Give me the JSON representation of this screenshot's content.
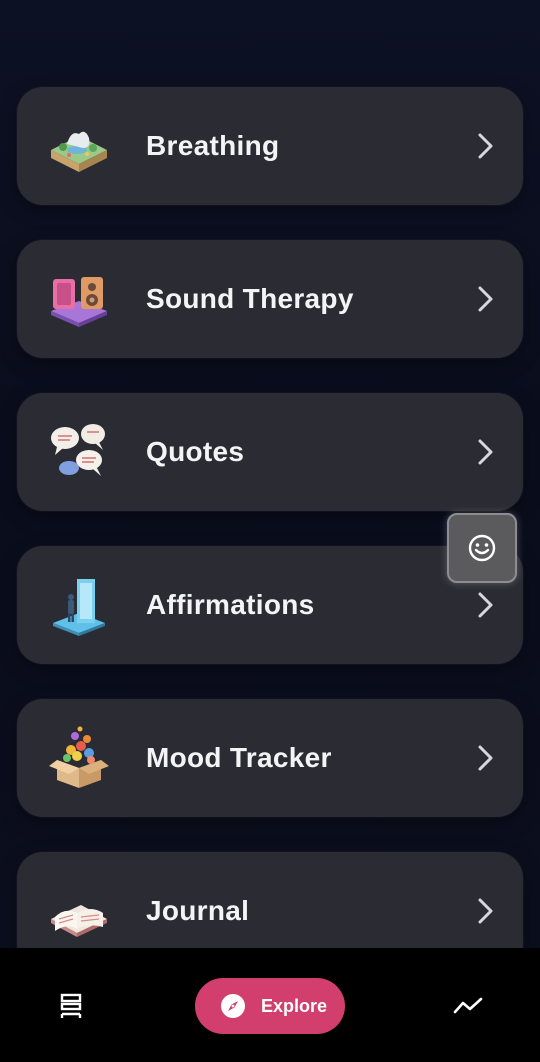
{
  "menu": {
    "items": [
      {
        "label": "Breathing",
        "icon": "breathing-garden-icon"
      },
      {
        "label": "Sound Therapy",
        "icon": "speaker-icon"
      },
      {
        "label": "Quotes",
        "icon": "speech-bubbles-icon"
      },
      {
        "label": "Affirmations",
        "icon": "mirror-icon"
      },
      {
        "label": "Mood Tracker",
        "icon": "mood-box-icon"
      },
      {
        "label": "Journal",
        "icon": "open-book-icon"
      }
    ]
  },
  "floating_button": {
    "icon": "smiley-face-icon"
  },
  "bottom_nav": {
    "left_icon": "stack-icon",
    "explore_label": "Explore",
    "explore_icon": "compass-icon",
    "right_icon": "trend-line-icon"
  },
  "colors": {
    "background": "#0d1124",
    "card": "#2b2c33",
    "accent": "#d23f6e",
    "nav_bar": "#000000"
  }
}
